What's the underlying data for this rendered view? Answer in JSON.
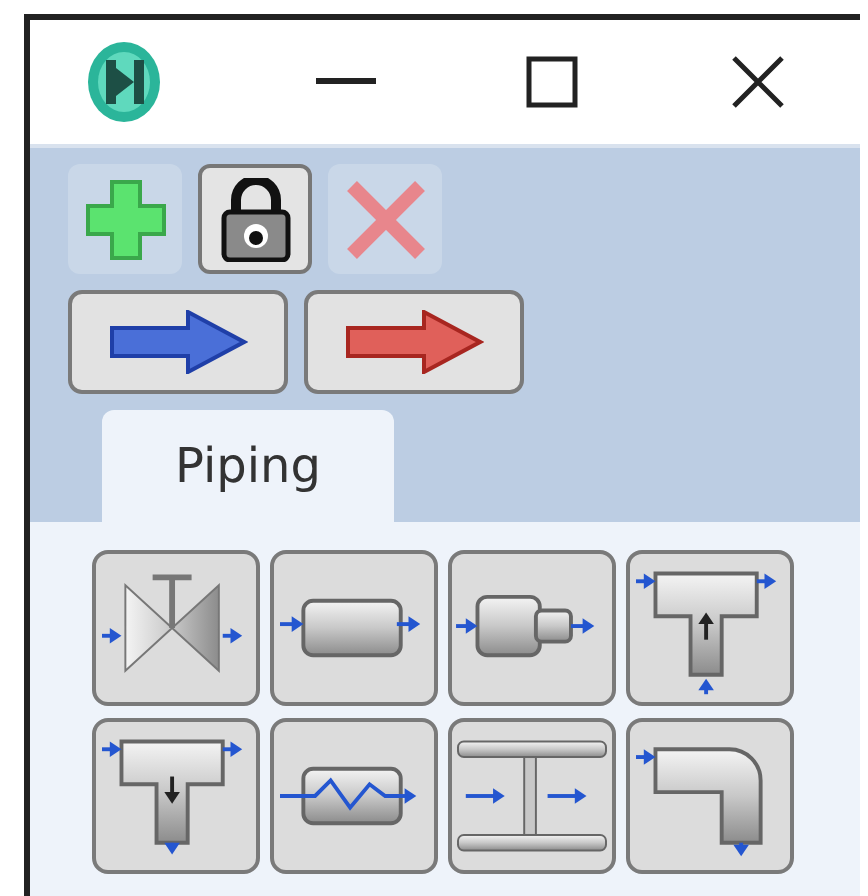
{
  "title_bar": {
    "controls": [
      {
        "kind": "minimize"
      },
      {
        "kind": "maximize"
      },
      {
        "kind": "close"
      }
    ]
  },
  "toolbar": [
    {
      "kind": "add",
      "pressed": false
    },
    {
      "kind": "lock",
      "pressed": true
    },
    {
      "kind": "delete",
      "pressed": false
    }
  ],
  "direction_buttons": [
    {
      "kind": "blue"
    },
    {
      "kind": "red"
    }
  ],
  "tabs": [
    {
      "label": "Piping",
      "selected": true
    }
  ],
  "palette": [
    {
      "kind": "valve"
    },
    {
      "kind": "pipe"
    },
    {
      "kind": "reducer"
    },
    {
      "kind": "tee-in"
    },
    {
      "kind": "tee-out"
    },
    {
      "kind": "heat-exchanger"
    },
    {
      "kind": "orifice"
    },
    {
      "kind": "elbow"
    }
  ]
}
